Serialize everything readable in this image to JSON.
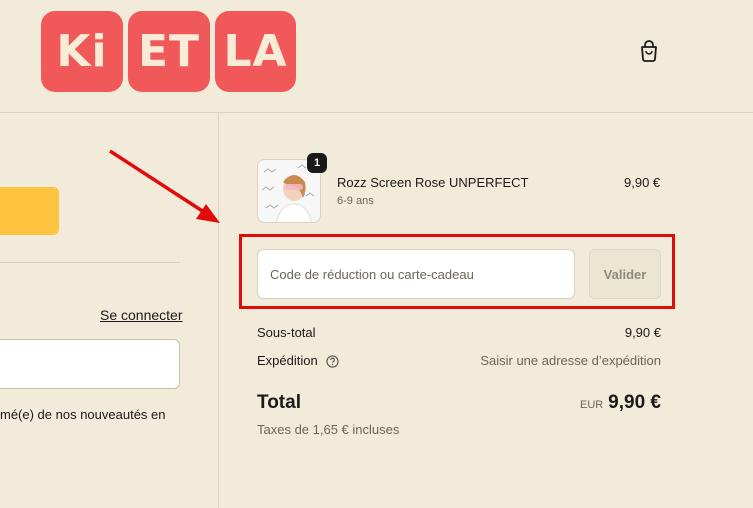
{
  "header": {
    "logo_parts": [
      "Ki",
      "ET",
      "LA"
    ],
    "cart_icon": "shopping-bag-icon"
  },
  "left": {
    "login_link": "Se connecter",
    "newsletter_text": "mé(e) de nos nouveautés en"
  },
  "order": {
    "product": {
      "name": "Rozz Screen Rose UNPERFECT",
      "variant": "6-9 ans",
      "price": "9,90 €",
      "quantity": "1"
    },
    "discount": {
      "placeholder": "Code de réduction ou carte-cadeau",
      "button": "Valider"
    },
    "subtotal": {
      "label": "Sous-total",
      "value": "9,90 €"
    },
    "shipping": {
      "label": "Expédition",
      "value": "Saisir une adresse d’expédition",
      "help_icon": "question-circle-icon"
    },
    "total": {
      "label": "Total",
      "currency": "EUR",
      "value": "9,90 €"
    },
    "taxes": "Taxes de 1,65 € incluses"
  },
  "colors": {
    "background": "#f2ebd9",
    "logo": "#f0585a",
    "annotation": "#e10b0b",
    "primary_button": "#ffc43f"
  }
}
